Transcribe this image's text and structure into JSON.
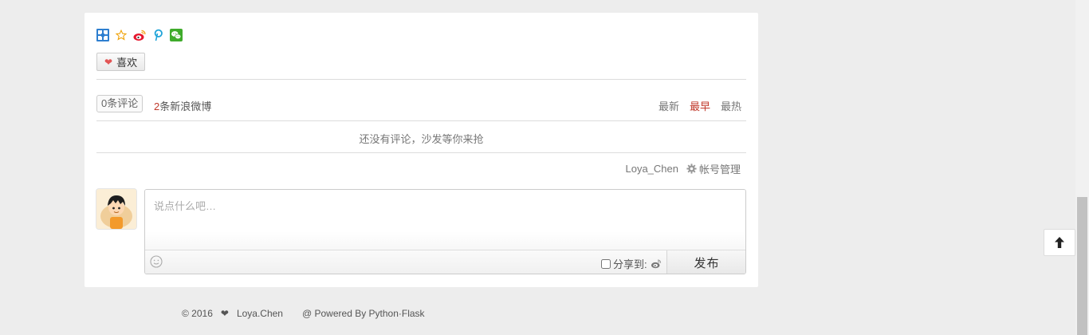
{
  "share": {
    "icons": [
      "plus-share-icon",
      "qzone-icon",
      "weibo-icon",
      "pinterest-icon",
      "wechat-icon"
    ]
  },
  "like": {
    "label": "喜欢",
    "icon": "heart-icon"
  },
  "comments": {
    "count_label": "0条评论",
    "weibo_num": "2",
    "weibo_label": "条新浪微博",
    "sort": {
      "latest": "最新",
      "earliest": "最早",
      "hottest": "最热",
      "active": "earliest"
    },
    "empty": "还没有评论，沙发等你来抢"
  },
  "account": {
    "username": "Loya_Chen",
    "manage_label": "帐号管理"
  },
  "editor": {
    "placeholder": "说点什么吧…",
    "share_to_label": "分享到:",
    "publish_label": "发布"
  },
  "footer": {
    "copyright": "© 2016",
    "author": "Loya.Chen",
    "powered": "@ Powered By Python·Flask"
  },
  "colors": {
    "accent": "#c0392b",
    "background": "#ededed",
    "card": "#ffffff"
  }
}
